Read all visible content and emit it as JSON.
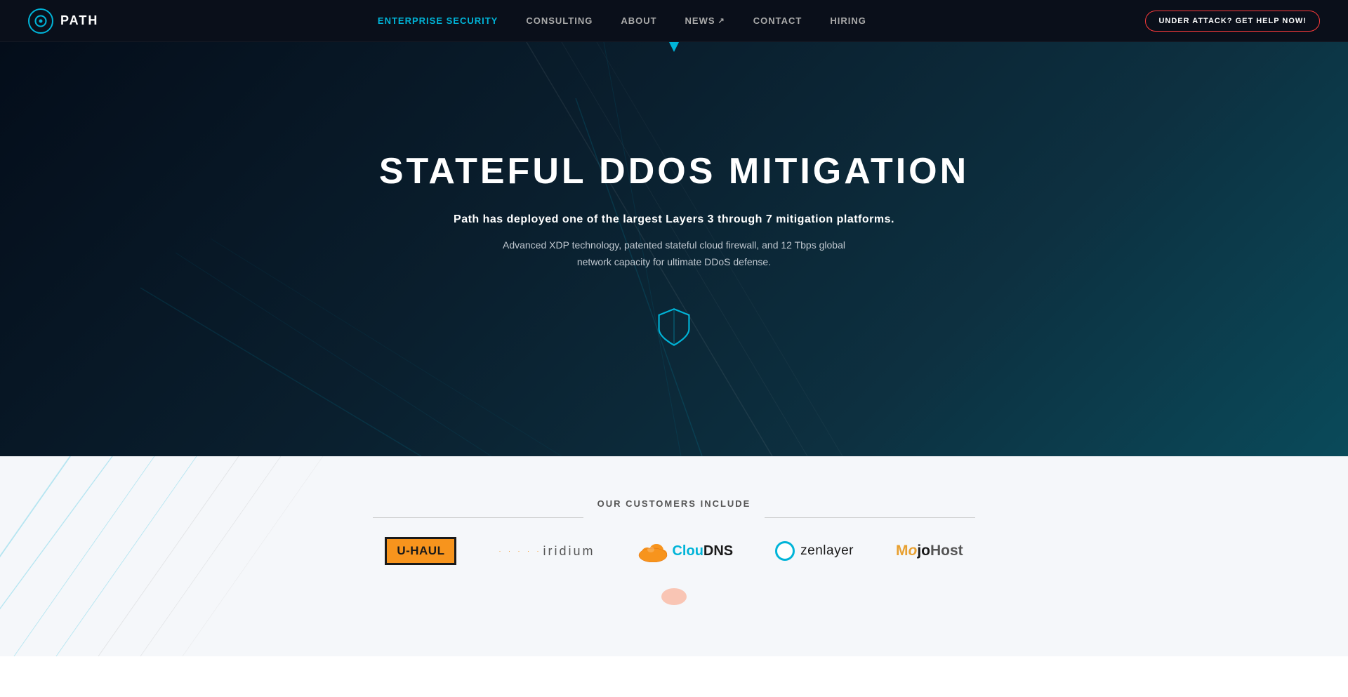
{
  "nav": {
    "logo_text": "PATH",
    "links": [
      {
        "label": "ENTERPRISE SECURITY",
        "active": true,
        "id": "enterprise-security"
      },
      {
        "label": "CONSULTING",
        "active": false,
        "id": "consulting"
      },
      {
        "label": "ABOUT",
        "active": false,
        "id": "about"
      },
      {
        "label": "NEWS",
        "active": false,
        "id": "news",
        "external": true
      },
      {
        "label": "CONTACT",
        "active": false,
        "id": "contact"
      },
      {
        "label": "HIRING",
        "active": false,
        "id": "hiring"
      }
    ],
    "cta_label": "UNDER ATTACK? GET HELP NOW!",
    "colors": {
      "active_link": "#00b4d8",
      "cta_border": "#ff3b3b"
    }
  },
  "hero": {
    "title": "STATEFUL DDOS MITIGATION",
    "subtitle": "Path has deployed one of the largest Layers 3 through 7 mitigation platforms.",
    "description": "Advanced XDP technology, patented stateful cloud firewall, and 12 Tbps global network capacity for ultimate DDoS defense."
  },
  "customers": {
    "section_title": "OUR CUSTOMERS INCLUDE",
    "logos": [
      {
        "name": "U-Haul",
        "id": "uhaul"
      },
      {
        "name": "Iridium",
        "id": "iridium"
      },
      {
        "name": "ClouDNS",
        "id": "cloudns"
      },
      {
        "name": "Zenlayer",
        "id": "zenlayer"
      },
      {
        "name": "MojoHost",
        "id": "mojohost"
      }
    ]
  }
}
